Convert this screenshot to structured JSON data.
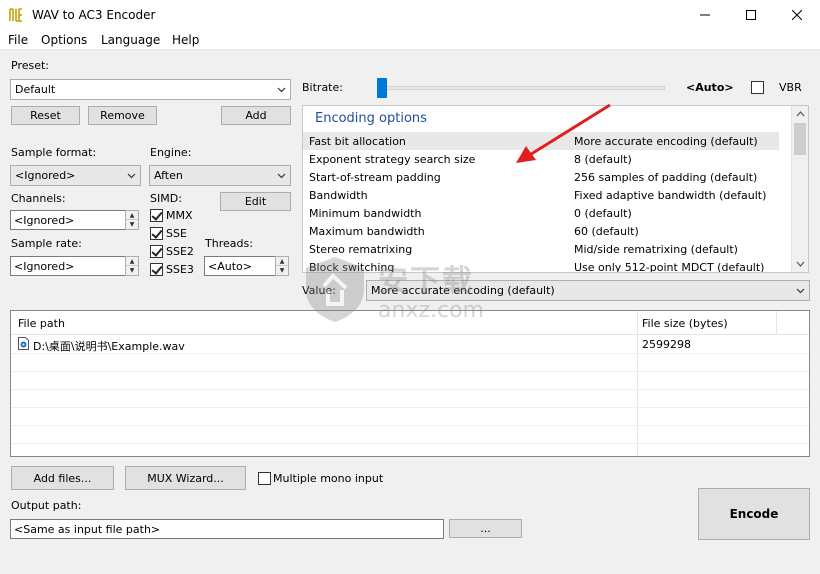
{
  "window": {
    "title": "WAV to AC3 Encoder",
    "accent": "#0078d7"
  },
  "menu": [
    "File",
    "Options",
    "Language",
    "Help"
  ],
  "preset": {
    "label": "Preset:",
    "value": "Default",
    "reset": "Reset",
    "remove": "Remove",
    "add": "Add"
  },
  "sample_format": {
    "label": "Sample format:",
    "value": "<Ignored>"
  },
  "engine": {
    "label": "Engine:",
    "value": "Aften"
  },
  "channels": {
    "label": "Channels:",
    "value": "<Ignored>"
  },
  "simd": {
    "label": "SIMD:",
    "edit": "Edit",
    "items": [
      {
        "label": "MMX",
        "checked": true
      },
      {
        "label": "SSE",
        "checked": true
      },
      {
        "label": "SSE2",
        "checked": true
      },
      {
        "label": "SSE3",
        "checked": true
      }
    ]
  },
  "sample_rate": {
    "label": "Sample rate:",
    "value": "<Ignored>"
  },
  "threads": {
    "label": "Threads:",
    "value": "<Auto>"
  },
  "bitrate": {
    "label": "Bitrate:",
    "value": "<Auto>",
    "vbr": "VBR",
    "vbr_checked": false,
    "slider_position": 0
  },
  "encoding_options": {
    "header": "Encoding options",
    "rows": [
      {
        "name": "Fast bit allocation",
        "value": "More accurate encoding (default)"
      },
      {
        "name": "Exponent strategy search size",
        "value": "8 (default)"
      },
      {
        "name": "Start-of-stream padding",
        "value": "256 samples of padding (default)"
      },
      {
        "name": "Bandwidth",
        "value": "Fixed adaptive bandwidth (default)"
      },
      {
        "name": "Minimum bandwidth",
        "value": "0 (default)"
      },
      {
        "name": "Maximum bandwidth",
        "value": "60 (default)"
      },
      {
        "name": "Stereo rematrixing",
        "value": "Mid/side rematrixing (default)"
      },
      {
        "name": "Block switching",
        "value": "Use only 512-point MDCT (default)"
      }
    ]
  },
  "value_field": {
    "label": "Value:",
    "value": "More accurate encoding (default)"
  },
  "files": {
    "col_path": "File path",
    "col_size": "File size (bytes)",
    "rows": [
      {
        "path": "D:\\桌面\\说明书\\Example.wav",
        "size": "2599298"
      }
    ]
  },
  "buttons": {
    "add_files": "Add files...",
    "mux_wizard": "MUX Wizard...",
    "multiple_mono": "Multiple mono input",
    "browse": "...",
    "encode": "Encode"
  },
  "output": {
    "label": "Output path:",
    "value": "<Same as input file path>"
  },
  "watermark": {
    "text_cn": "安下载",
    "text_en": "anxz.com"
  }
}
